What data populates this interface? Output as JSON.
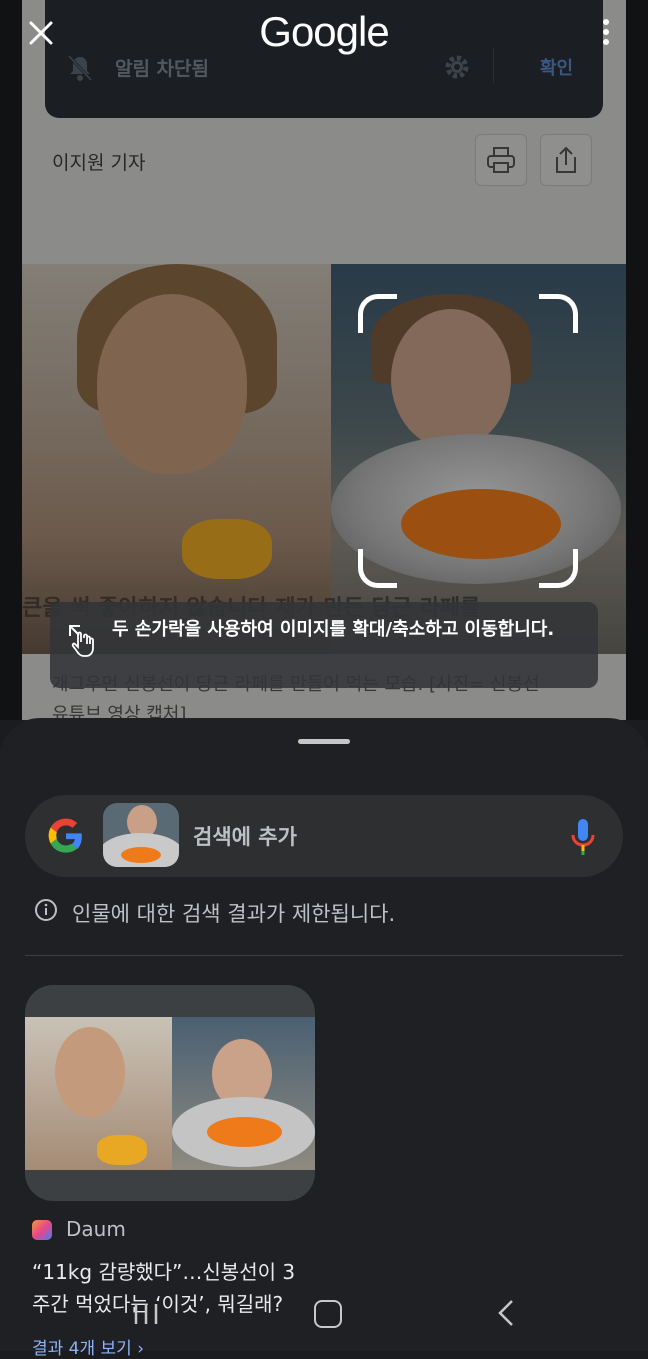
{
  "top_bar": {
    "logo": "Google",
    "close_label": "✕"
  },
  "background_article": {
    "notification": {
      "text": "알림 차단됨",
      "confirm": "확인"
    },
    "reporter": "이지원 기자",
    "image_subtitle": "큰을 썩 좋아하지 않습니다   제가 만든 당근 라페를",
    "caption_line1": "개그우먼 신봉선이 당근 라페를 만들어 먹는 모습. [사진= 신봉선",
    "caption_line2": "유튜브 영상 캡처]"
  },
  "toast": {
    "text": "두 손가락을 사용하여 이미지를 확대/축소하고 이동합니다."
  },
  "search_bar": {
    "placeholder": "검색에 추가"
  },
  "notice": {
    "text": "인물에 대한 검색 결과가 제한됩니다."
  },
  "result": {
    "source": "Daum",
    "title": "“11kg 감량했다”…신봉선이 3주간 먹었다는 ‘이것’, 뭐길래?",
    "more_label": "결과 4개 보기"
  },
  "colors": {
    "sheet_bg": "#1f2023",
    "search_bg": "#2d2f31",
    "link": "#8ab4f8"
  }
}
